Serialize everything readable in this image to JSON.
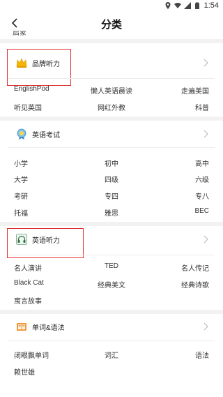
{
  "status": {
    "time": "1:54"
  },
  "header": {
    "title": "分类"
  },
  "partial_text": "启蒙",
  "sections": [
    {
      "title": "品牌听力",
      "rows": [
        [
          "EnglishPod",
          "懒人英语晨读",
          "走遍美国"
        ],
        [
          "听见英国",
          "网红外教",
          "科普"
        ]
      ]
    },
    {
      "title": "英语考试",
      "rows": [
        [
          "小学",
          "初中",
          "高中"
        ],
        [
          "大学",
          "四级",
          "六级"
        ],
        [
          "考研",
          "专四",
          "专八"
        ],
        [
          "托福",
          "雅思",
          "BEC"
        ]
      ]
    },
    {
      "title": "英语听力",
      "rows": [
        [
          "名人演讲",
          "TED",
          "名人传记"
        ],
        [
          "Black Cat",
          "经典美文",
          "经典诗歌"
        ],
        [
          "寓言故事",
          "",
          ""
        ]
      ]
    },
    {
      "title": "单词&语法",
      "rows": [
        [
          "闭眼飘单词",
          "词汇",
          "语法"
        ],
        [
          "赖世雄",
          "",
          ""
        ]
      ]
    }
  ],
  "colors": {
    "highlight": "#e03030",
    "divider": "#f2f2f2"
  }
}
